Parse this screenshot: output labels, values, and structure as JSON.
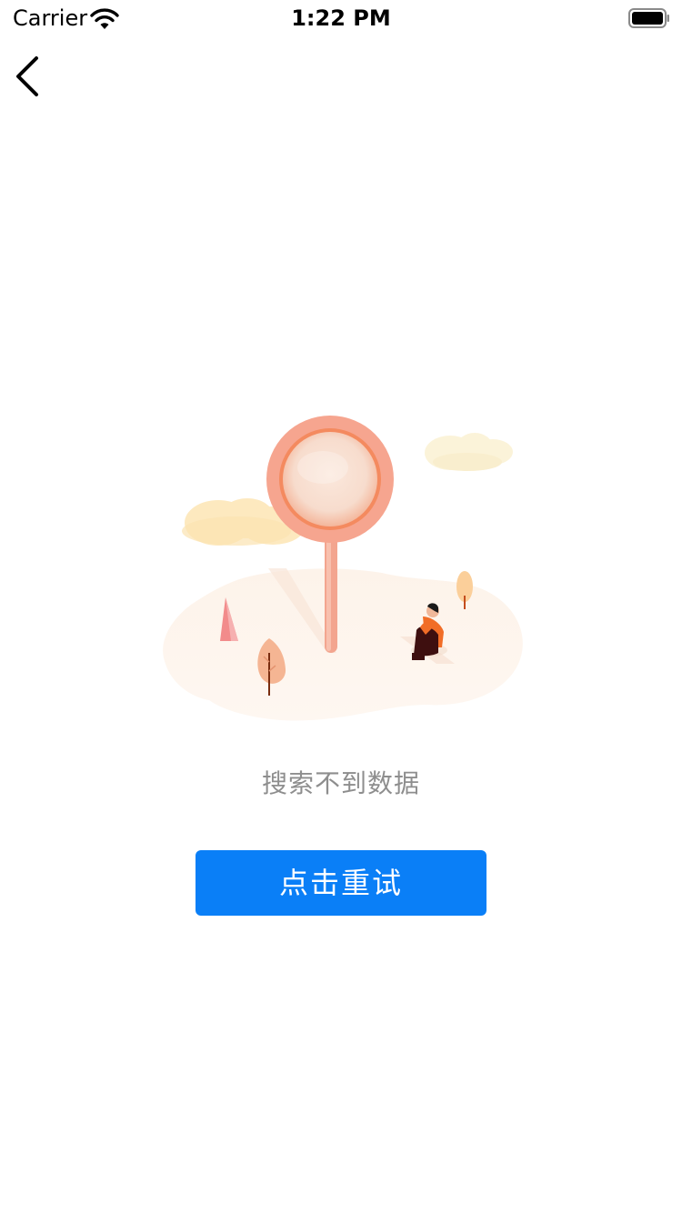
{
  "status_bar": {
    "carrier": "Carrier",
    "time": "1:22 PM"
  },
  "navigation": {
    "back_icon": "chevron-left-icon"
  },
  "empty_state": {
    "illustration": "magnifier-search-empty-illustration",
    "message": "搜索不到数据",
    "message_color": "#8e8e8e"
  },
  "retry": {
    "label": "点击重试",
    "color": "#0a7ff7"
  }
}
